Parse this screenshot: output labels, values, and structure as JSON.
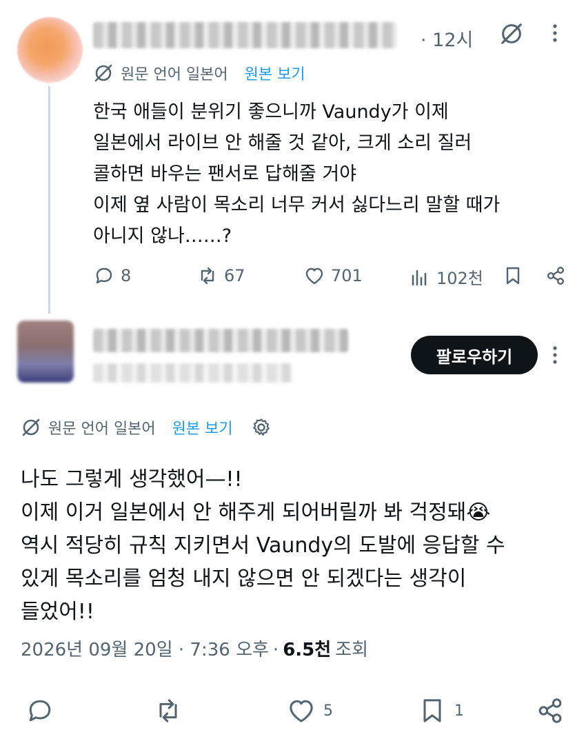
{
  "tweet1": {
    "time": "· 12시",
    "translation": {
      "label": "원문 언어 일본어",
      "link": "원본 보기"
    },
    "lines": [
      "한국 애들이 분위기 좋으니까 Vaundy가 이제",
      "일본에서 라이브 안 해줄 것 같아, 크게 소리 질러",
      "콜하면 바우는 팬서로 답해줄 거야",
      "이제 옆 사람이 목소리 너무 커서 싫다느리 말할 때가",
      "아니지 않나……?"
    ],
    "actions": {
      "replies": "8",
      "retweets": "67",
      "likes": "701",
      "views": "102천"
    }
  },
  "tweet2": {
    "follow_label": "팔로우하기",
    "translation": {
      "label": "원문 언어 일본어",
      "link": "원본 보기"
    },
    "lines": [
      "나도 그렇게 생각했어—!!",
      "이제 이거 일본에서 안 해주게 되어버릴까 봐 걱정돼😭",
      "역시 적당히 규칙 지키면서 Vaundy의 도발에 응답할 수",
      "있게 목소리를 엄청 내지 않으면 안 되겠다는 생각이",
      "들었어!!"
    ],
    "meta": {
      "date": "2026년 09월 20일 · 7:36 오후",
      "dot": "·",
      "views": "6.5천",
      "views_label": "조회"
    },
    "actions": {
      "likes": "5",
      "bookmarks": "1"
    }
  },
  "icons": {
    "translate": "translate-icon",
    "grok": "grok-icon",
    "settings": "gear-icon"
  },
  "colors": {
    "accent": "#1d9bf0",
    "text": "#0f1419",
    "muted": "#536471",
    "button": "#0f1419"
  }
}
